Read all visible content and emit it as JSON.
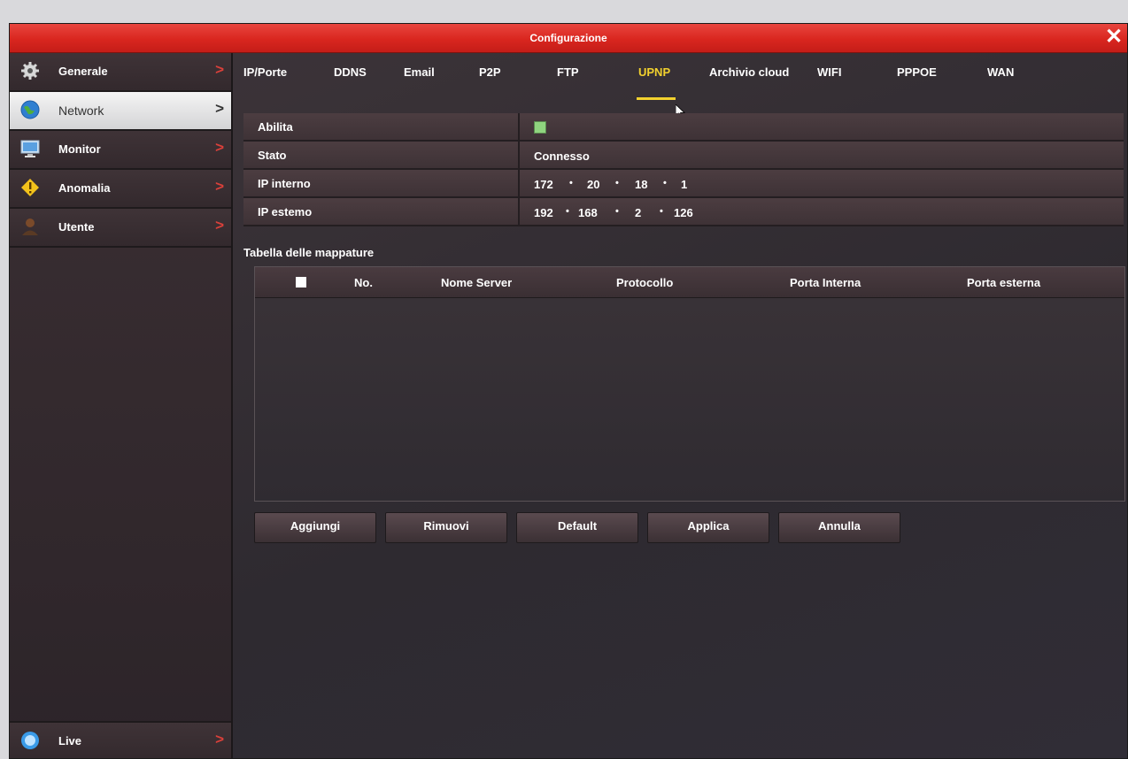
{
  "window": {
    "title": "Configurazione",
    "close_glyph": "✕"
  },
  "sidebar": {
    "items": [
      {
        "label": "Generale",
        "icon": "gear-icon"
      },
      {
        "label": "Network",
        "icon": "globe-icon",
        "selected": true
      },
      {
        "label": "Monitor",
        "icon": "monitor-icon"
      },
      {
        "label": "Anomalia",
        "icon": "warning-icon"
      },
      {
        "label": "Utente",
        "icon": "user-icon"
      }
    ],
    "live": {
      "label": "Live",
      "icon": "live-icon"
    },
    "chevron": ">"
  },
  "tabs": [
    "IP/Porte",
    "DDNS",
    "Email",
    "P2P",
    "FTP",
    "UPNP",
    "Archivio cloud",
    "WIFI",
    "PPPOE",
    "WAN"
  ],
  "active_tab": "UPNP",
  "form": {
    "enable": {
      "label": "Abilita",
      "checked": true
    },
    "status": {
      "label": "Stato",
      "value": "Connesso"
    },
    "internal_ip": {
      "label": "IP interno",
      "octets": [
        "172",
        "20",
        "18",
        "1"
      ]
    },
    "external_ip": {
      "label": "IP estemo",
      "octets": [
        "192",
        "168",
        "2",
        "126"
      ]
    }
  },
  "mapping": {
    "title": "Tabella delle mappature",
    "columns": [
      "No.",
      "Nome Server",
      "Protocollo",
      "Porta Interna",
      "Porta esterna"
    ],
    "rows": []
  },
  "buttons": [
    "Aggiungi",
    "Rimuovi",
    "Default",
    "Applica",
    "Annulla"
  ],
  "colors": {
    "title_bar": "#d9261f",
    "active_tab": "#f2d12e",
    "chevron": "#d9403a"
  }
}
